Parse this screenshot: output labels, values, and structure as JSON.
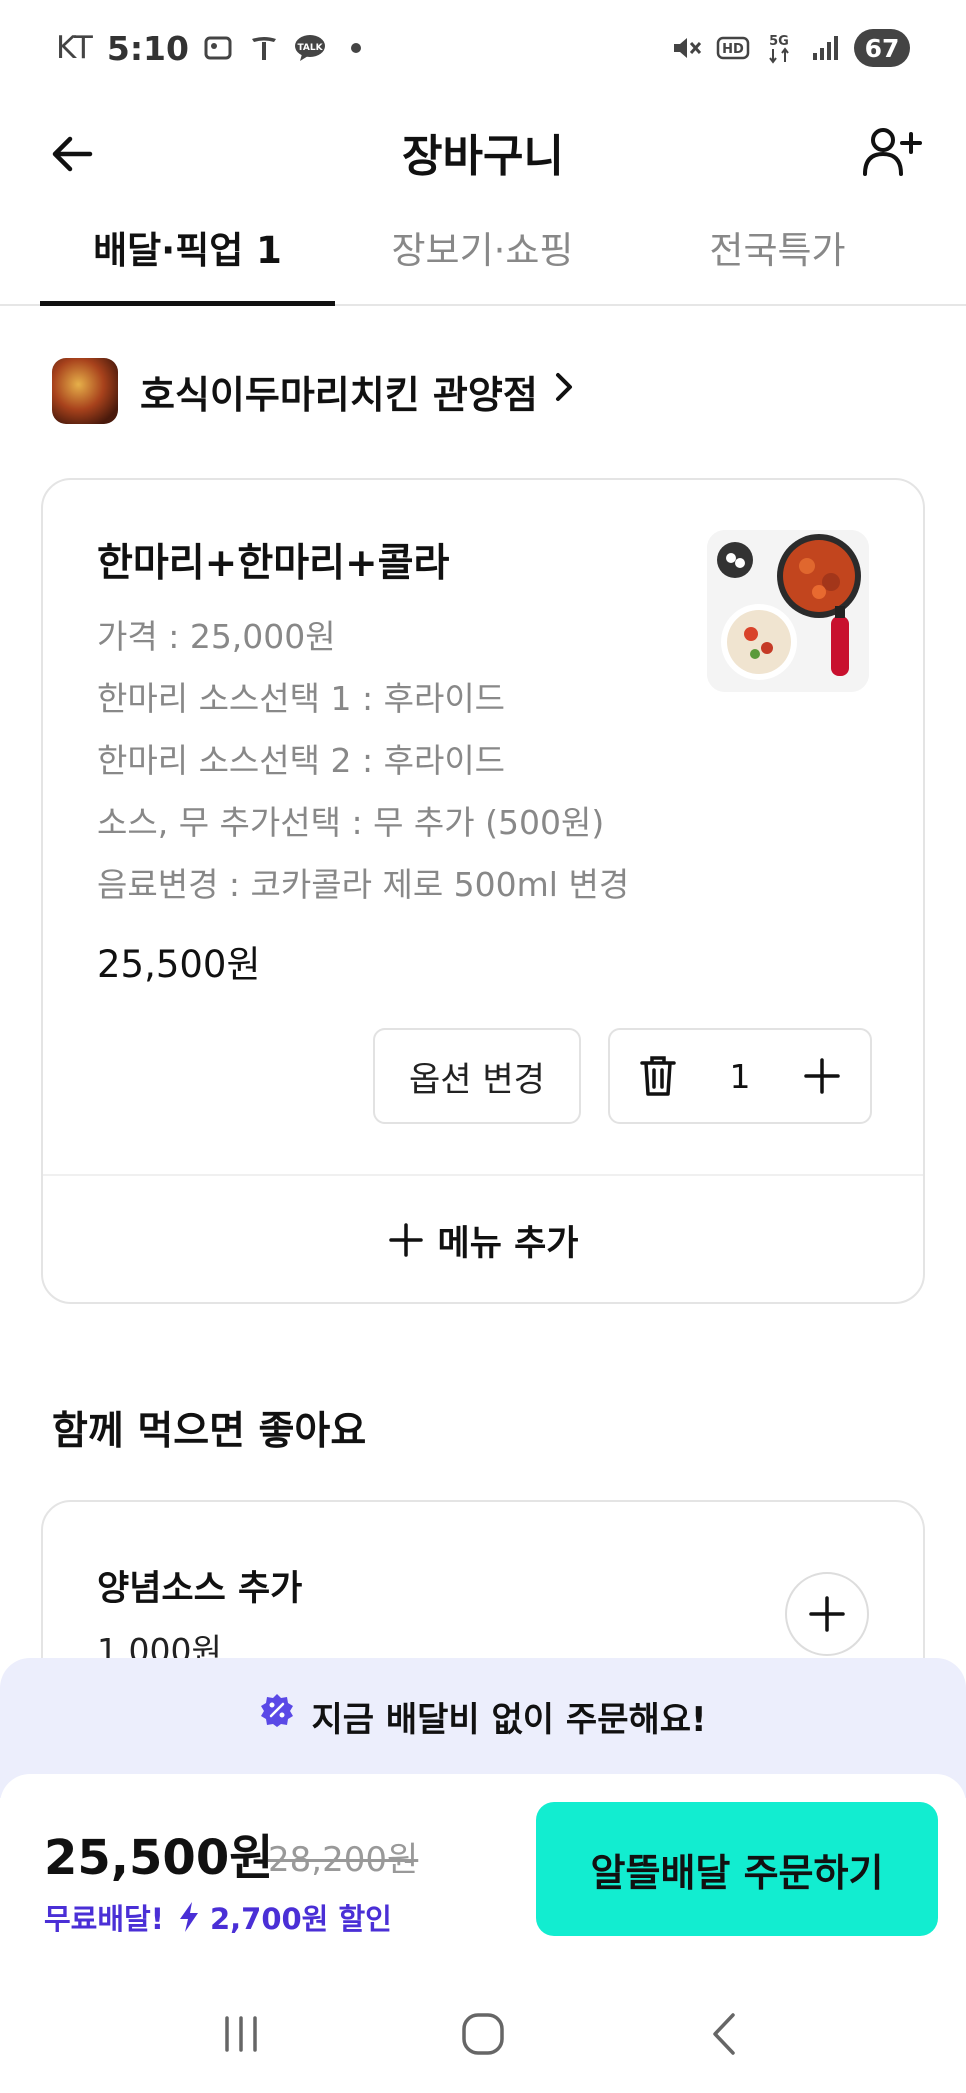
{
  "status_bar": {
    "carrier": "KT",
    "time": "5:10",
    "battery": "67",
    "icons": [
      "gallery-icon",
      "tesla-icon",
      "talk-icon",
      "dot-icon",
      "mute-icon",
      "hd-icon",
      "5g-icon",
      "signal-icon"
    ]
  },
  "header": {
    "title": "장바구니",
    "back_icon": "arrow-left-icon",
    "invite_icon": "add-person-icon"
  },
  "tabs": [
    {
      "label": "배달·픽업 1",
      "active": true
    },
    {
      "label": "장보기·쇼핑",
      "active": false
    },
    {
      "label": "전국특가",
      "active": false
    }
  ],
  "store": {
    "name": "호식이두마리치킨 관양점",
    "chevron": "›"
  },
  "cart_item": {
    "name": "한마리+한마리+콜라",
    "options": [
      "가격 : 25,000원",
      "한마리 소스선택 1 : 후라이드",
      "한마리 소스선택 2 : 후라이드",
      "소스, 무 추가선택 : 무 추가 (500원)",
      "음료변경 : 코카콜라 제로 500ml 변경"
    ],
    "price": "25,500원",
    "option_change_label": "옵션 변경",
    "quantity": "1",
    "add_menu_label": "메뉴 추가"
  },
  "recommendation": {
    "title": "함께 먹으면 좋아요",
    "item_name": "양념소스 추가",
    "item_price": "1,000원"
  },
  "promo": {
    "text": "지금 배달비 없이 주문해요!"
  },
  "checkout": {
    "total": "25,500원",
    "original": "28,200원",
    "free_delivery": "무료배달!",
    "discount": "2,700원 할인",
    "order_label": "알뜰배달 주문하기"
  },
  "colors": {
    "accent_mint": "#12edd0",
    "discount_purple": "#4a2fd6",
    "promo_bg": "#eceefc"
  }
}
